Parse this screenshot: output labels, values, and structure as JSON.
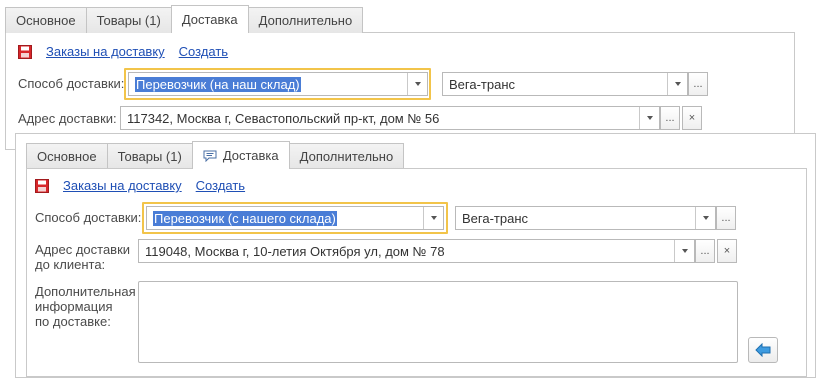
{
  "back_form": {
    "tabs": [
      "Основное",
      "Товары (1)",
      "Доставка",
      "Дополнительно"
    ],
    "active_tab": "Доставка",
    "orders_link": "Заказы на доставку",
    "create_link": "Создать",
    "delivery_method_label": "Способ доставки:",
    "delivery_method_value": "Перевозчик (на наш склад)",
    "carrier_value": "Вега-транс",
    "address_label": "Адрес доставки:",
    "address_value": "117342, Москва г, Севастопольский пр-кт, дом № 56",
    "ellipsis": "...",
    "clear": "×"
  },
  "front_form": {
    "tabs": [
      "Основное",
      "Товары (1)",
      "Доставка",
      "Дополнительно"
    ],
    "active_tab": "Доставка",
    "orders_link": "Заказы на доставку",
    "create_link": "Создать",
    "delivery_method_label": "Способ доставки:",
    "delivery_method_value": "Перевозчик (с нашего склада)",
    "carrier_value": "Вега-транс",
    "address_label_line1": "Адрес доставки",
    "address_label_line2": "до клиента:",
    "address_value": "119048, Москва г, 10-летия Октября ул, дом № 78",
    "extra_label_line1": "Дополнительная",
    "extra_label_line2": "информация",
    "extra_label_line3": "по доставке:",
    "extra_value": "",
    "ellipsis": "...",
    "clear": "×"
  },
  "colors": {
    "link": "#1f4fb5",
    "selection": "#4a7dd6",
    "focus_ring": "#f2c44a",
    "save_icon": "#d8262a",
    "transfer_icon": "#3d9be0"
  }
}
